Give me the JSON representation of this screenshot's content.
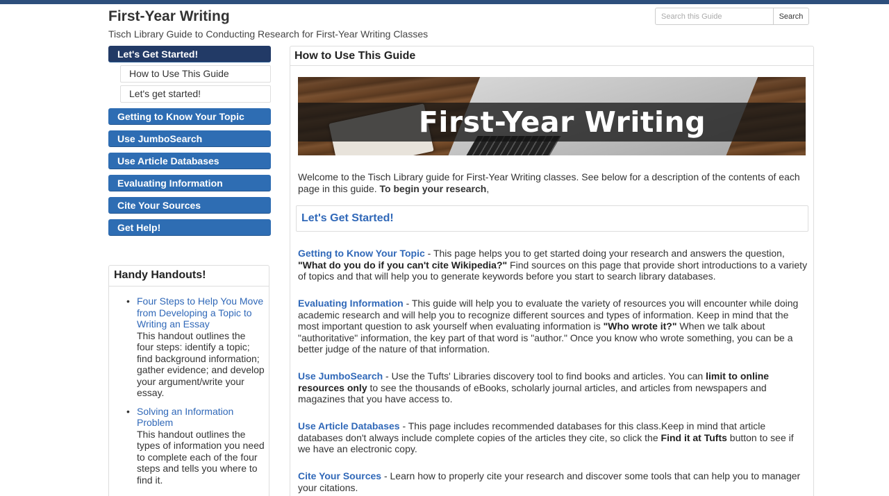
{
  "header": {
    "title": "First-Year Writing",
    "subtitle": "Tisch Library Guide to Conducting Research for First-Year Writing Classes",
    "search_placeholder": "Search this Guide",
    "search_button": "Search"
  },
  "nav": {
    "active": "Let's Get Started!",
    "subitems": [
      "How to Use This Guide",
      "Let's get started!"
    ],
    "items": [
      "Getting to Know Your Topic",
      "Use JumboSearch",
      "Use Article Databases",
      "Evaluating Information",
      "Cite Your Sources",
      "Get Help!"
    ]
  },
  "handouts": {
    "title": "Handy Handouts!",
    "items": [
      {
        "link": "Four Steps to Help You Move from Developing a Topic to Writing an Essay",
        "desc": "This handout outlines the four steps: identify a topic; find background information; gather evidence; and develop your argument/write your essay."
      },
      {
        "link": "Solving an Information Problem",
        "desc": "This handout outlines the types of information you need to complete each of the four steps and tells you where to find it."
      }
    ]
  },
  "main": {
    "title": "How to Use This Guide",
    "banner_text": "First-Year Writing",
    "intro_text": "Welcome to the Tisch Library guide for First-Year Writing classes. See below for a description of the contents of each page in this guide. ",
    "intro_bold": "To begin your research",
    "intro_tail": ",",
    "start_box": "Let's Get Started!",
    "sections": {
      "topic": {
        "link": "Getting to Know Your Topic",
        "t1": " - This page helps you to get started doing your research and answers the question, ",
        "b1": "\"What do you do if you can't cite Wikipedia?\"",
        "t2": " Find sources on this page that provide short introductions to a variety of topics and that will help you to generate keywords before you start to search library databases."
      },
      "evaluating": {
        "link": "Evaluating Information",
        "t1": " - This guide will help you to evaluate the variety of resources you will encounter while doing academic research and will help you to recognize different sources and types of information. Keep in mind that the most important question to ask yourself when evaluating information is ",
        "b1": "\"Who wrote it?\"",
        "t2": " When we talk about \"authoritative\" information, the key part of that word is \"author.\" Once you know who wrote something, you can be a better judge of the nature of that information."
      },
      "jumbo": {
        "link": "Use JumboSearch",
        "t1": " - Use the Tufts' Libraries discovery tool to find books and articles. You can ",
        "b1": "limit to online resources only",
        "t2": " to see the thousands of eBooks, scholarly journal articles, and articles from newspapers and magazines that you have access to."
      },
      "databases": {
        "link": "Use Article Databases",
        "t1": " - This page includes recommended databases for this class.Keep in mind that article databases don't always include complete copies of the articles they cite, so click the ",
        "b1": "Find it at Tufts",
        "t2": " button to see if we have an electronic copy."
      },
      "cite": {
        "link": "Cite Your Sources",
        "t1": " - Learn how to properly cite your research and discover some tools that can help you to manager your citations."
      }
    }
  }
}
